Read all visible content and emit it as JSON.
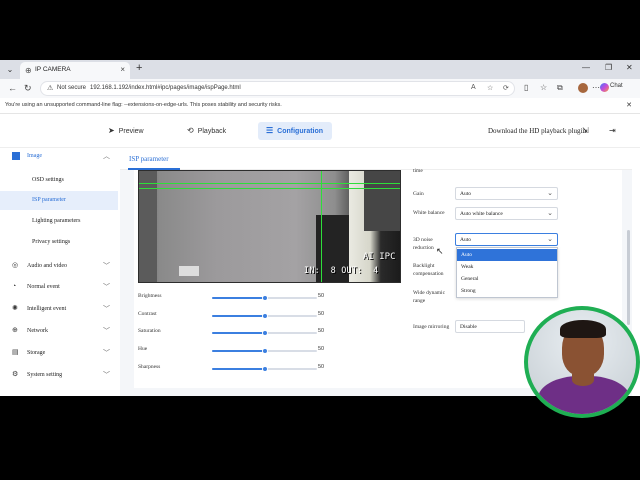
{
  "browser": {
    "tab_title": "IP CAMERA",
    "security_label": "Not secure",
    "url": "192.168.1.192/index.html#ipc/pages/image/ispPage.html",
    "chat_label": "Chat",
    "warning_text": "You're using an unsupported command-line flag: --extensions-on-edge-urls. This poses stability and security risks."
  },
  "topnav": {
    "preview": "Preview",
    "playback": "Playback",
    "configuration": "Configuration",
    "download": "Download the HD playback plugin"
  },
  "sidebar": {
    "image": "Image",
    "sub_items": [
      "OSD settings",
      "ISP parameter",
      "Lighting parameters",
      "Privacy settings"
    ],
    "groups": [
      "Audio and video",
      "Normal event",
      "Intelligent event",
      "Network",
      "Storage",
      "System setting"
    ]
  },
  "panel": {
    "title": "ISP parameter"
  },
  "osd": {
    "label": "AI IPC",
    "counter": "IN:  8 OUT:  4"
  },
  "sliders": [
    {
      "label": "Brightness",
      "value": 50
    },
    {
      "label": "Contrast",
      "value": 50
    },
    {
      "label": "Saturation",
      "value": 50
    },
    {
      "label": "Hue",
      "value": 50
    },
    {
      "label": "Sharpness",
      "value": 50
    }
  ],
  "settings": {
    "time_label": "time",
    "gain_label": "Gain",
    "gain_value": "Auto",
    "wb_label": "White balance",
    "wb_value": "Auto white balance",
    "nr_label": "3D noise reduction",
    "nr_value": "Auto",
    "nr_options": [
      "Auto",
      "Weak",
      "General",
      "Strong"
    ],
    "backlight_label": "Backlight compensation",
    "wdr_label": "Wide dynamic range",
    "mirror_label": "Image mirroring",
    "mirror_value": "Disable"
  },
  "colors": {
    "accent": "#2a6fd6",
    "osd_green": "#2ede3a",
    "webcam_ring": "#1fae53"
  }
}
